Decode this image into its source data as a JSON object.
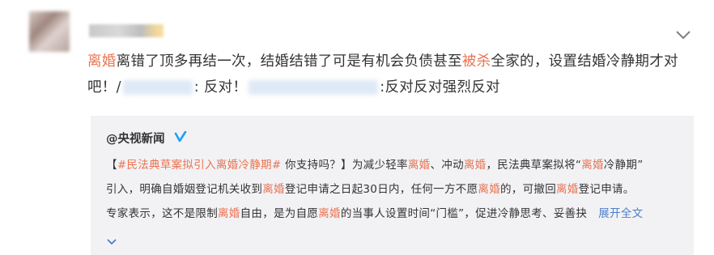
{
  "post": {
    "seg1": "离婚",
    "seg2": "离错了顶多再结一次，结婚结错了可是有机会负债甚至",
    "seg3": "被杀",
    "seg4": "全家的，设置结婚冷静期才对",
    "seg5": "吧！/",
    "seg6": ": 反对！",
    "seg7": ":反对反对强烈反对"
  },
  "repost": {
    "author": "@央视新闻",
    "l1": {
      "a": "【",
      "b": "#民法典草案拟引入",
      "c": "离婚",
      "d": "冷静期#",
      "e": " 你支持吗？】为减少轻率",
      "f": "离婚",
      "g": "、冲动",
      "h": "离婚",
      "i": "，民法典草案拟将“",
      "j": "离婚",
      "k": "冷静期”"
    },
    "l2": {
      "a": "引入，明确自婚姻登记机关收到",
      "b": "离婚",
      "c": "登记申请之日起30日内，任何一方不愿",
      "d": "离婚",
      "e": "的，可撤回",
      "f": "离婚",
      "g": "登记申请。"
    },
    "l3": {
      "a": "专家表示，这不是限制",
      "b": "离婚",
      "c": "自由，是为自愿",
      "d": "离婚",
      "e": "的当事人设置时间“门槛”，促进冷静思考、妥善抉",
      "expand": "展开全文"
    }
  },
  "icons": {
    "menu": "chevron-down-icon",
    "verified": "verified-badge-icon",
    "expand": "chevron-down-icon"
  },
  "colors": {
    "highlight": "#eb7350",
    "link": "#4d7ec6",
    "repost_bg": "#f2f2f5",
    "verified": "#1da1f2"
  }
}
